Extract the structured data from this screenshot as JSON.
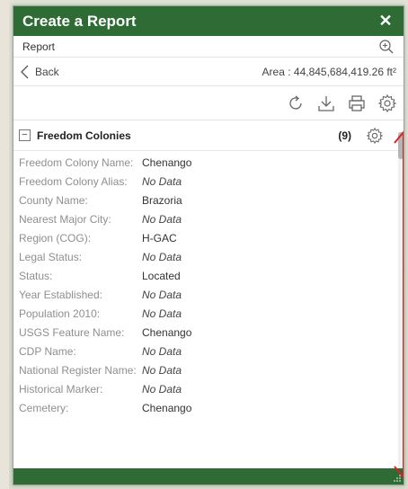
{
  "window": {
    "title": "Create a Report",
    "close_label": "✕"
  },
  "report_row": {
    "label": "Report"
  },
  "back_row": {
    "back_label": "Back",
    "area_text": "Area : 44,845,684,419.26 ft²"
  },
  "section": {
    "title": "Freedom Colonies",
    "count": "(9)",
    "collapse_glyph": "−"
  },
  "fields": [
    {
      "label": "Freedom Colony Name:",
      "value": "Chenango",
      "nodata": false
    },
    {
      "label": "Freedom Colony Alias:",
      "value": "No Data",
      "nodata": true
    },
    {
      "label": "County Name:",
      "value": "Brazoria",
      "nodata": false
    },
    {
      "label": "Nearest Major City:",
      "value": "No Data",
      "nodata": true
    },
    {
      "label": "Region (COG):",
      "value": "H-GAC",
      "nodata": false
    },
    {
      "label": "Legal Status:",
      "value": "No Data",
      "nodata": true
    },
    {
      "label": "Status:",
      "value": "Located",
      "nodata": false
    },
    {
      "label": "Year Established:",
      "value": "No Data",
      "nodata": true
    },
    {
      "label": "Population 2010:",
      "value": "No Data",
      "nodata": true
    },
    {
      "label": "USGS Feature Name:",
      "value": "Chenango",
      "nodata": false
    },
    {
      "label": "CDP Name:",
      "value": "No Data",
      "nodata": true
    },
    {
      "label": "National Register Name:",
      "value": "No Data",
      "nodata": true
    },
    {
      "label": "Historical Marker:",
      "value": "No Data",
      "nodata": true
    },
    {
      "label": "Cemetery:",
      "value": "Chenango",
      "nodata": false
    }
  ],
  "icons": {
    "zoom": "zoom-in-icon",
    "back": "chevron-left-icon",
    "refresh": "refresh-icon",
    "download": "download-icon",
    "print": "print-icon",
    "settings": "gear-icon"
  },
  "colors": {
    "header": "#2e6b35",
    "arrow": "#e02020",
    "label": "#8f8f8f"
  }
}
